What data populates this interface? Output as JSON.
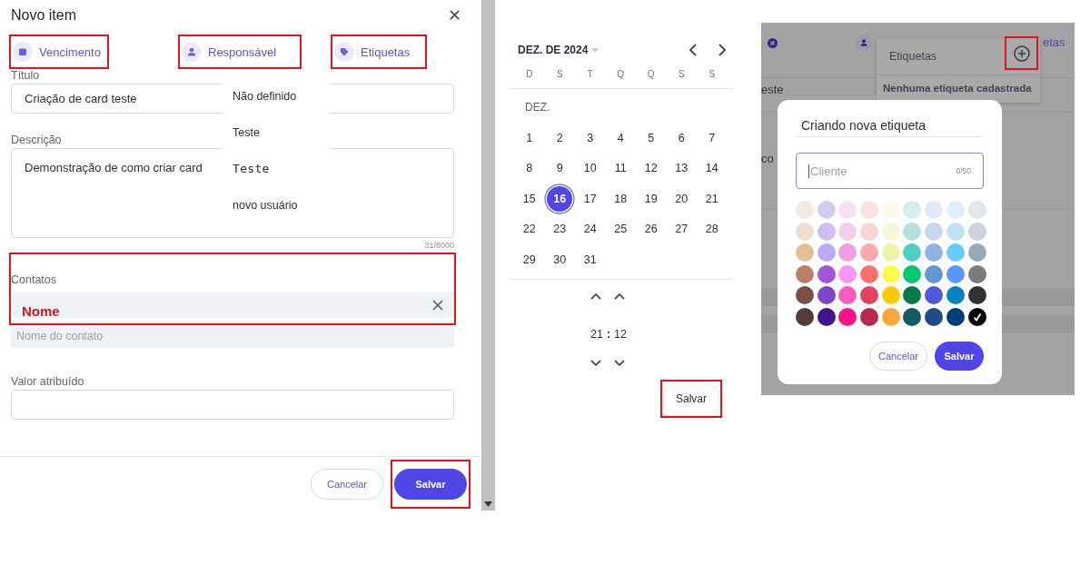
{
  "item_dialog": {
    "title": "Novo item",
    "close": "✕",
    "tabs": [
      {
        "label": "Vencimento",
        "kind": "calendar",
        "highlighted": true
      },
      {
        "label": "Responsável",
        "kind": "person",
        "highlighted": true
      },
      {
        "label": "Etiquetas",
        "kind": "tag",
        "highlighted": true
      }
    ],
    "title_field": {
      "label": "Título",
      "value": "Criação de card teste"
    },
    "assignee_menu": [
      {
        "label": "Não definido",
        "kind": "plain"
      },
      {
        "label": "Teste",
        "kind": "plain"
      },
      {
        "label": "Teste",
        "kind": "wide"
      },
      {
        "label": "novo usuário",
        "kind": "plain"
      }
    ],
    "description": {
      "label": "Descrição",
      "value": "Demonstração de como criar card",
      "counter": "31/8000"
    },
    "contacts": {
      "label": "Contatos",
      "highlighted": true,
      "annotation": "Nome",
      "placeholder": "Nome do contato"
    },
    "value_field": {
      "label": "Valor atribuído"
    },
    "buttons": [
      {
        "label": "Cancelar",
        "kind": "secondary",
        "highlighted": false
      },
      {
        "label": "Salvar",
        "kind": "primary",
        "highlighted": true
      }
    ]
  },
  "date_picker": {
    "month": "DEZ. DE 2024",
    "weekdays": [
      "D",
      "S",
      "T",
      "Q",
      "Q",
      "S",
      "S"
    ],
    "month_label": "DEZ.",
    "weeks": [
      [
        {
          "day": "1",
          "selected": false
        },
        {
          "day": "2",
          "selected": false
        },
        {
          "day": "3",
          "selected": false
        },
        {
          "day": "4",
          "selected": false
        },
        {
          "day": "5",
          "selected": false
        },
        {
          "day": "6",
          "selected": false
        },
        {
          "day": "7",
          "selected": false
        }
      ],
      [
        {
          "day": "8",
          "selected": false
        },
        {
          "day": "9",
          "selected": false
        },
        {
          "day": "10",
          "selected": false
        },
        {
          "day": "11",
          "selected": false
        },
        {
          "day": "12",
          "selected": false
        },
        {
          "day": "13",
          "selected": false
        },
        {
          "day": "14",
          "selected": false
        }
      ],
      [
        {
          "day": "15",
          "selected": false
        },
        {
          "day": "16",
          "selected": true
        },
        {
          "day": "17",
          "selected": false
        },
        {
          "day": "18",
          "selected": false
        },
        {
          "day": "19",
          "selected": false
        },
        {
          "day": "20",
          "selected": false
        },
        {
          "day": "21",
          "selected": false
        }
      ],
      [
        {
          "day": "22",
          "selected": false
        },
        {
          "day": "23",
          "selected": false
        },
        {
          "day": "24",
          "selected": false
        },
        {
          "day": "25",
          "selected": false
        },
        {
          "day": "26",
          "selected": false
        },
        {
          "day": "27",
          "selected": false
        },
        {
          "day": "28",
          "selected": false
        }
      ],
      [
        {
          "day": "29",
          "selected": false
        },
        {
          "day": "30",
          "selected": false
        },
        {
          "day": "31",
          "selected": false
        }
      ]
    ],
    "hour": "21",
    "separator": ":",
    "minute": "12",
    "save_button": {
      "label": "Salvar",
      "highlighted": true
    }
  },
  "tag_panel": {
    "background_fragments": [
      "etas",
      "este",
      "co"
    ],
    "popover": {
      "title": "Etiquetas",
      "add_highlighted": true,
      "empty_text": "Nenhuma etiqueta cadastrada"
    },
    "new_tag_dialog": {
      "title": "Criando nova etiqueta",
      "placeholder": "Cliente",
      "counter": "0/50",
      "swatches": [
        [
          {
            "color": "#f3e9df",
            "selected": false
          },
          {
            "color": "#d4cbf5",
            "selected": false
          },
          {
            "color": "#f8e1f4",
            "selected": false
          },
          {
            "color": "#fbe2e2",
            "selected": false
          },
          {
            "color": "#fbfbe8",
            "selected": false
          },
          {
            "color": "#d8eeeb",
            "selected": false
          },
          {
            "color": "#e2e9f6",
            "selected": false
          },
          {
            "color": "#dcefff",
            "selected": false
          },
          {
            "color": "#e3e6ea",
            "selected": false
          }
        ],
        [
          {
            "color": "#eedfcc",
            "selected": false
          },
          {
            "color": "#cbbff3",
            "selected": false
          },
          {
            "color": "#f1d0ee",
            "selected": false
          },
          {
            "color": "#f7d4d4",
            "selected": false
          },
          {
            "color": "#f6f7d6",
            "selected": false
          },
          {
            "color": "#b6e0dc",
            "selected": false
          },
          {
            "color": "#c8d6ee",
            "selected": false
          },
          {
            "color": "#bfe1f8",
            "selected": false
          },
          {
            "color": "#cfd3da",
            "selected": false
          }
        ],
        [
          {
            "color": "#e2c096",
            "selected": false
          },
          {
            "color": "#bda8f6",
            "selected": false
          },
          {
            "color": "#f39ee0",
            "selected": false
          },
          {
            "color": "#fba8a8",
            "selected": false
          },
          {
            "color": "#f2f2a6",
            "selected": false
          },
          {
            "color": "#4fcfc4",
            "selected": false
          },
          {
            "color": "#8fb4e4",
            "selected": false
          },
          {
            "color": "#66ccfa",
            "selected": false
          },
          {
            "color": "#98a9b6",
            "selected": false
          }
        ],
        [
          {
            "color": "#ba7e69",
            "selected": false
          },
          {
            "color": "#9f55d6",
            "selected": false
          },
          {
            "color": "#fb95f5",
            "selected": false
          },
          {
            "color": "#fc706d",
            "selected": false
          },
          {
            "color": "#fcfc4a",
            "selected": false
          },
          {
            "color": "#00c771",
            "selected": false
          },
          {
            "color": "#6496d2",
            "selected": false
          },
          {
            "color": "#5798fa",
            "selected": false
          },
          {
            "color": "#7c7c7c",
            "selected": false
          }
        ],
        [
          {
            "color": "#7a5046",
            "selected": false
          },
          {
            "color": "#7b46c9",
            "selected": false
          },
          {
            "color": "#fb5bbc",
            "selected": false
          },
          {
            "color": "#e0435c",
            "selected": false
          },
          {
            "color": "#fdc900",
            "selected": false
          },
          {
            "color": "#007a48",
            "selected": false
          },
          {
            "color": "#5059d9",
            "selected": false
          },
          {
            "color": "#0085c1",
            "selected": false
          },
          {
            "color": "#323232",
            "selected": false
          }
        ],
        [
          {
            "color": "#553c3a",
            "selected": false
          },
          {
            "color": "#3b1790",
            "selected": false
          },
          {
            "color": "#fd1387",
            "selected": false
          },
          {
            "color": "#b72b4e",
            "selected": false
          },
          {
            "color": "#fca73c",
            "selected": false
          },
          {
            "color": "#165a63",
            "selected": false
          },
          {
            "color": "#204a8a",
            "selected": false
          },
          {
            "color": "#003e79",
            "selected": false
          },
          {
            "color": "#000000",
            "selected": true
          }
        ]
      ],
      "buttons": [
        {
          "label": "Cancelar",
          "kind": "secondary"
        },
        {
          "label": "Salvar",
          "kind": "primary"
        }
      ]
    }
  }
}
